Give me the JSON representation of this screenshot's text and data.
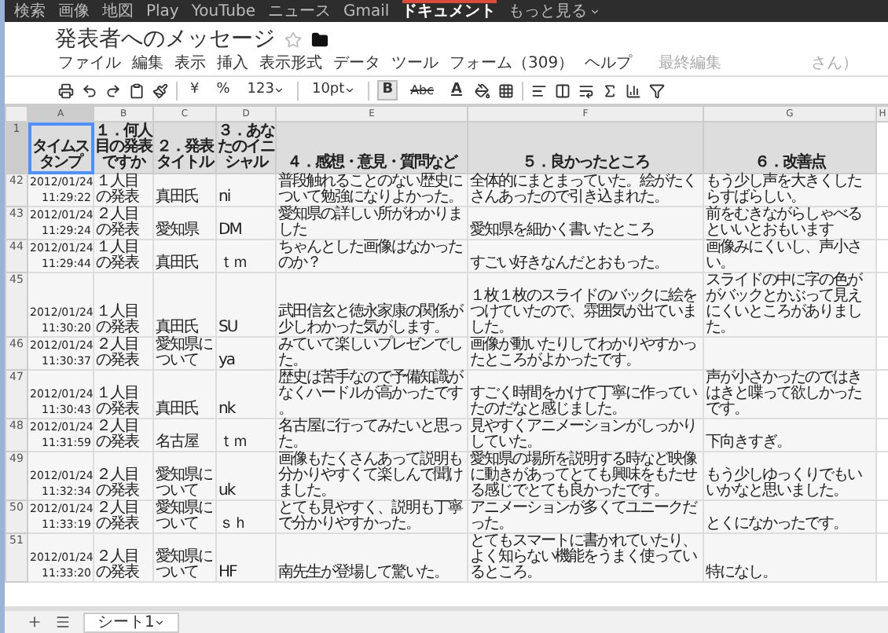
{
  "nav_bar": {
    "items": [
      {
        "label": "検索",
        "selected": false
      },
      {
        "label": "画像",
        "selected": false
      },
      {
        "label": "地図",
        "selected": false
      },
      {
        "label": "Play",
        "selected": false
      },
      {
        "label": "YouTube",
        "selected": false
      },
      {
        "label": "ニュース",
        "selected": false
      },
      {
        "label": "Gmail",
        "selected": false
      },
      {
        "label": "ドキュメント",
        "selected": true
      }
    ],
    "more": "もっと見る"
  },
  "document": {
    "title": "発表者へのメッセージ",
    "starred": false
  },
  "menu": [
    "ファイル",
    "編集",
    "表示",
    "挿入",
    "表示形式",
    "データ",
    "ツール",
    "フォーム（309）",
    "ヘルプ"
  ],
  "last_edit": [
    "最終編集",
    "さん）"
  ],
  "toolbar": {
    "currency": "¥",
    "percent": "%",
    "number_format": "123",
    "font_size": "10pt",
    "bold": "B",
    "bold_selected": true,
    "strike": "Abc",
    "text_color": "A"
  },
  "sheet": {
    "columns": [
      {
        "letter": "A",
        "selected": true
      },
      {
        "letter": "B",
        "selected": false
      },
      {
        "letter": "C",
        "selected": false
      },
      {
        "letter": "D",
        "selected": false
      },
      {
        "letter": "E",
        "selected": false
      },
      {
        "letter": "F",
        "selected": false
      },
      {
        "letter": "G",
        "selected": false
      },
      {
        "letter": "H",
        "selected": false
      }
    ],
    "header_row": {
      "number": "1",
      "cells": [
        "タイムスタンプ",
        "１．何人目の発表ですか",
        "２．発表タイトル",
        "３．あなたのイニシャル",
        "４．感想・意見・質問など",
        "５．良かったところ",
        "６．改善点"
      ]
    },
    "rows": [
      {
        "number": "42",
        "cells": [
          "2012/01/24 11:29:22",
          "１人目の発表",
          "真田氏",
          "ni",
          "普段触れることのない歴史について勉強になりよかった。",
          "全体的にまとまっていた。絵がたくさんあったので引き込まれた。",
          "もう少し声を大きくしたらすばらしい。"
        ]
      },
      {
        "number": "43",
        "cells": [
          "2012/01/24 11:29:24",
          "２人目の発表",
          "愛知県",
          "DM",
          "愛知県の詳しい所がわかりました",
          "愛知県を細かく書いたところ",
          "前をむきながらしゃべるといいとおもいます"
        ]
      },
      {
        "number": "44",
        "cells": [
          "2012/01/24 11:29:44",
          "１人目の発表",
          "真田氏",
          "ｔｍ",
          "ちゃんとした画像はなかったのか？",
          "すごい好きなんだとおもった。",
          "画像みにくいし、声小さい。"
        ]
      },
      {
        "number": "45",
        "cells": [
          "2012/01/24 11:30:20",
          "１人目の発表",
          "真田氏",
          "SU",
          "武田信玄と徳永家康の関係が少しわかった気がします。",
          "１枚１枚のスライドのバックに絵をつけていたので、雰囲気が出ていました。",
          "スライドの中に字の色ががバックとかぶって見えにくいところがありました。"
        ]
      },
      {
        "number": "46",
        "cells": [
          "2012/01/24 11:30:37",
          "２人目の発表",
          "愛知県について",
          "ya",
          "みていて楽しいプレゼンでした。",
          "画像が動いたりしてわかりやすかったところがよかったです。",
          null
        ]
      },
      {
        "number": "47",
        "cells": [
          "2012/01/24 11:30:43",
          "１人目の発表",
          "真田氏",
          "nk",
          "歴史は苦手なので予備知識がなくハードルが高かったです。",
          "すごく時間をかけて丁寧に作っていたのだなと感じました。",
          "声が小さかったのではきはきと喋って欲しかったです。"
        ]
      },
      {
        "number": "48",
        "cells": [
          "2012/01/24 11:31:59",
          "２人目の発表",
          "名古屋",
          "ｔｍ",
          "名古屋に行ってみたいと思った。",
          "見やすくアニメーションがしっかりしていた。",
          "下向きすぎ。"
        ]
      },
      {
        "number": "49",
        "cells": [
          "2012/01/24 11:32:34",
          "２人目の発表",
          "愛知県について",
          "uk",
          "画像もたくさんあって説明も分かりやすくて楽しんで聞けました。",
          "愛知県の場所を説明する時など映像に動きがあってとても興味をもたせる感じでとても良かったです。",
          "もう少しゆっくりでもいいかなと思いました。"
        ]
      },
      {
        "number": "50",
        "cells": [
          "2012/01/24 11:33:19",
          "２人目の発表",
          "愛知県について",
          "ｓｈ",
          "とても見やすく、説明も丁寧で分かりやすかった。",
          "アニメーションが多くてユニークだった。",
          "とくになかったです。"
        ]
      },
      {
        "number": "51",
        "cells": [
          "2012/01/24 11:33:20",
          "２人目の発表",
          "愛知県について",
          "HF",
          "南先生が登場して驚いた。",
          "とてもスマートに書かれていたり、よく知らない機能をうまく使っているところ。",
          "特になし。"
        ]
      }
    ]
  },
  "sheet_tabs": [
    {
      "label": "シート1",
      "selected": true
    }
  ]
}
